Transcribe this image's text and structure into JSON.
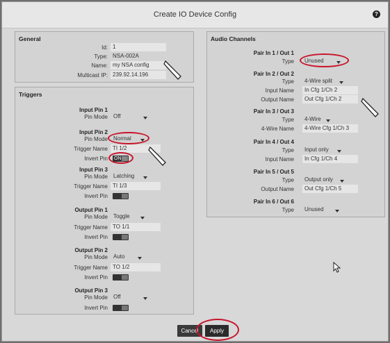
{
  "dialog": {
    "title": "Create IO Device Config"
  },
  "general": {
    "title": "General",
    "fields": [
      {
        "label": "Id:",
        "value": "1"
      },
      {
        "label": "Type:",
        "value": "NSA-002A"
      },
      {
        "label": "Name:",
        "value": "my NSA config"
      },
      {
        "label": "Multicast IP:",
        "value": "239.92.14.196"
      }
    ]
  },
  "triggers": {
    "title": "Triggers",
    "input_pin1": {
      "header": "Input Pin 1",
      "pin_mode_label": "Pin Mode",
      "pin_mode": "Off"
    },
    "input_pin2": {
      "header": "Input Pin 2",
      "pin_mode_label": "Pin Mode",
      "pin_mode": "Normal",
      "trigger_name_label": "Trigger Name",
      "trigger_name": "TI 1/2",
      "invert_label": "Invert Pin",
      "invert_text": "ON"
    },
    "input_pin3": {
      "header": "Input Pin 3",
      "pin_mode_label": "Pin Mode",
      "pin_mode": "Latching",
      "trigger_name_label": "Trigger Name",
      "trigger_name": "TI 1/3",
      "invert_label": "Invert Pin"
    },
    "output_pin1": {
      "header": "Output Pin 1",
      "pin_mode_label": "Pin Mode",
      "pin_mode": "Toggle",
      "trigger_name_label": "Trigger Name",
      "trigger_name": "TO 1/1",
      "invert_label": "Invert Pin"
    },
    "output_pin2": {
      "header": "Output Pin 2",
      "pin_mode_label": "Pin Mode",
      "pin_mode": "Auto",
      "trigger_name_label": "Trigger Name",
      "trigger_name": "TO 1/2",
      "invert_label": "Invert Pin"
    },
    "output_pin3": {
      "header": "Output Pin 3",
      "pin_mode_label": "Pin Mode",
      "pin_mode": "Off",
      "invert_label": "Invert Pin"
    }
  },
  "audio": {
    "title": "Audio Channels",
    "pair1": {
      "header": "Pair In 1 / Out 1",
      "type_label": "Type",
      "type": "Unused"
    },
    "pair2": {
      "header": "Pair In 2 / Out 2",
      "type_label": "Type",
      "type": "4-Wire split",
      "input_name_label": "Input Name",
      "input_name": "In Cfg 1/Ch 2",
      "output_name_label": "Output Name",
      "output_name": "Out Cfg 1/Ch 2"
    },
    "pair3": {
      "header": "Pair In 3 / Out 3",
      "type_label": "Type",
      "type": "4-Wire",
      "wire_name_label": "4-Wire Name",
      "wire_name": "4-Wire Cfg 1/Ch 3"
    },
    "pair4": {
      "header": "Pair In 4 / Out 4",
      "type_label": "Type",
      "type": "Input only",
      "input_name_label": "Input Name",
      "input_name": "In Cfg 1/Ch 4"
    },
    "pair5": {
      "header": "Pair In 5 / Out 5",
      "type_label": "Type",
      "type": "Output only",
      "output_name_label": "Output Name",
      "output_name": "Out Cfg 1/Ch 5"
    },
    "pair6": {
      "header": "Pair In 6 / Out 6",
      "type_label": "Type",
      "type": "Unused"
    }
  },
  "footer": {
    "cancel_label": "Cancel",
    "apply_label": "Apply"
  },
  "colors": {
    "highlight_ring": "#c8152b",
    "dialog_bg": "#d8d8d8",
    "panel_bg": "#d3d3d3",
    "overlay": "#6e6e6e"
  },
  "icons": [
    "help-icon",
    "pen-cursor-icon",
    "mouse-pointer-icon",
    "chevron-down-icon",
    "toggle-switch-icon"
  ]
}
